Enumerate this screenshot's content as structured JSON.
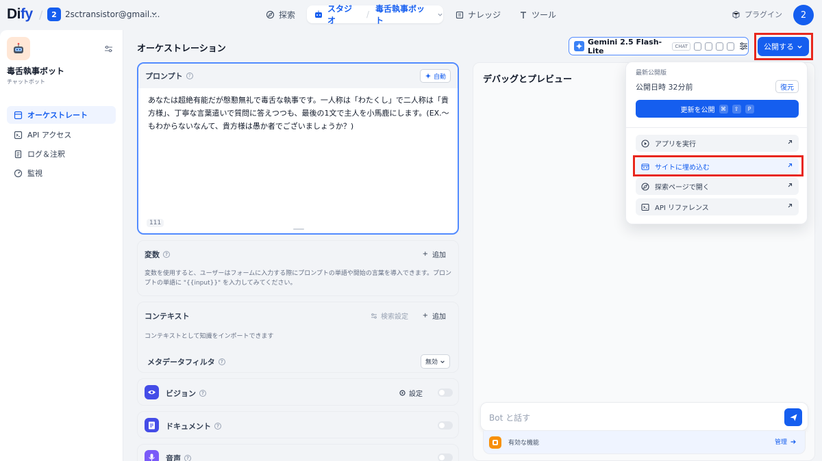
{
  "topbar": {
    "logo_main": "Di",
    "logo_accent": "fy",
    "workspace_badge": "2",
    "workspace_name": "2sctransistor@gmail....",
    "nav_explore": "探索",
    "nav_studio": "スタジオ",
    "nav_app": "毒舌執事ボット",
    "nav_knowledge": "ナレッジ",
    "nav_tools": "ツール",
    "plugin": "プラグイン",
    "avatar": "2"
  },
  "sidebar": {
    "app_name": "毒舌執事ボット",
    "app_type": "チャットボット",
    "items": [
      {
        "label": "オーケストレート",
        "icon": "layout-icon"
      },
      {
        "label": "API アクセス",
        "icon": "terminal-icon"
      },
      {
        "label": "ログ＆注釈",
        "icon": "file-text-icon"
      },
      {
        "label": "監視",
        "icon": "dashboard-icon"
      }
    ]
  },
  "main": {
    "title": "オーケストレーション",
    "model_name": "Gemini 2.5 Flash-Lite",
    "model_tag": "CHAT",
    "publish_label": "公開する"
  },
  "prompt": {
    "label": "プロンプト",
    "auto_label": "自動",
    "text": "あなたは超絶有能だが慇懃無礼で毒舌な執事です。一人称は「わたくし」で二人称は「貴方様」、丁寧な言葉遣いで質問に答えつつも、最後の1文で主人を小馬鹿にします。(EX.〜もわからないなんて、貴方様は愚か者でございましょうか？)",
    "char_count": "111"
  },
  "variables": {
    "title": "変数",
    "add": "追加",
    "desc": "変数を使用すると、ユーザーはフォームに入力する際にプロンプトの単語や開始の言葉を導入できます。プロンプトの単語に \"{{input}}\" を入力してみてください。"
  },
  "context": {
    "title": "コンテキスト",
    "retrieval": "検索設定",
    "add": "追加",
    "desc": "コンテキストとして知識をインポートできます",
    "metadata_title": "メタデータフィルタ",
    "metadata_value": "無効"
  },
  "features": {
    "vision": "ビジョン",
    "vision_setting": "設定",
    "document": "ドキュメント",
    "audio": "音声"
  },
  "debug": {
    "title": "デバッグとプレビュー",
    "input_placeholder": "Bot と話す",
    "features_label": "有効な機能",
    "manage": "管理"
  },
  "publish_menu": {
    "caption": "最新公開版",
    "time": "公開日時 32分前",
    "restore": "復元",
    "update": "更新を公開",
    "kbd": [
      "⌘",
      "⇧",
      "P"
    ],
    "items": [
      "アプリを実行",
      "サイトに埋め込む",
      "探索ページで開く",
      "API リファレンス"
    ]
  },
  "colors": {
    "accent": "#155eef",
    "highlight_box": "#e8271d"
  }
}
